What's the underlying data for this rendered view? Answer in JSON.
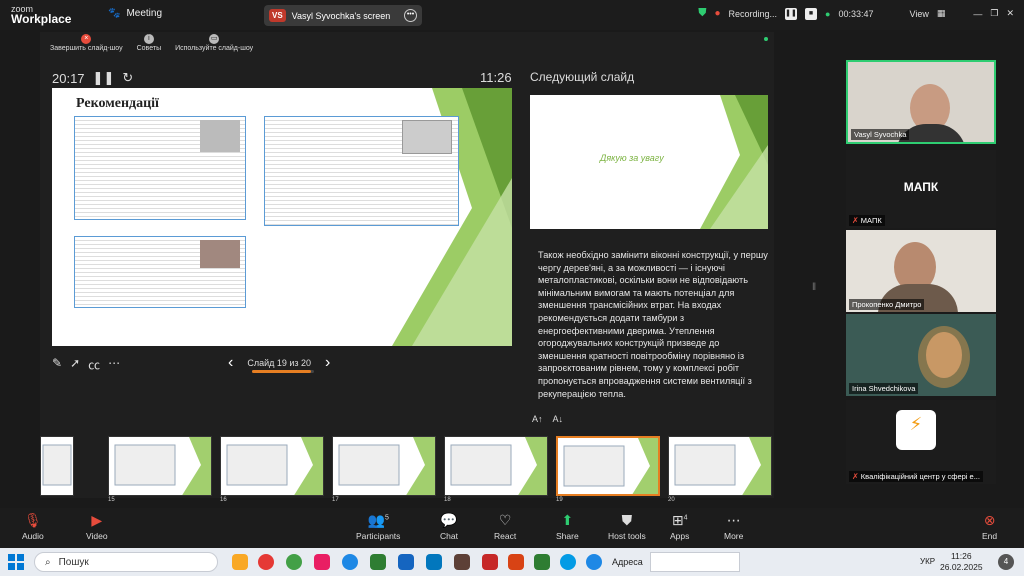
{
  "app": {
    "logo_line1": "zoom",
    "logo_line2": "Workplace",
    "meeting_label": "Meeting"
  },
  "share": {
    "badge": "VS",
    "title": "Vasyl Syvochka's screen"
  },
  "status": {
    "recording": "Recording...",
    "elapsed": "00:33:47",
    "view": "View"
  },
  "presenter": {
    "toolbar": [
      "Завершить слайд-шоу",
      "Советы",
      "Используйте слайд-шоу"
    ],
    "timer": "20:17",
    "clock": "11:26",
    "next_label": "Следующий слайд",
    "slide_nav": "Слайд 19 из 20",
    "progress": 0.95,
    "notes": "Також необхідно замінити віконні конструкції, у першу чергу дерев'яні, а за можливості — і існуючі металопластикові, оскільки вони не відповідають мінімальним вимогам та мають потенціал для зменшення трансмісійних втрат. На входах рекомендується додати тамбури з енергоефективними дверима. Утеплення огороджувальних конструкцій призведе до зменшення кратності повітрообміну порівняно із запроєктованим рівнем, тому у комплексі робіт пропонується впровадження системи вентиляції з рекуперацією тепла."
  },
  "slide": {
    "title": "Рекомендації"
  },
  "next_slide": {
    "text": "Дякую за увагу"
  },
  "thumbnails": [
    "15",
    "16",
    "17",
    "18",
    "19",
    "20"
  ],
  "participants_panel": {
    "tiles": [
      {
        "name": "Vasyl Syvochka"
      },
      {
        "name": "МАПК",
        "label": "МАПК"
      },
      {
        "name": "Прокопенко Дмитро"
      },
      {
        "name": "Irina Shvedchikova"
      },
      {
        "name": "Кваліфікаційний центр у сфері е..."
      }
    ]
  },
  "controls": {
    "audio": "Audio",
    "video": "Video",
    "participants": "Participants",
    "participants_count": "5",
    "chat": "Chat",
    "react": "React",
    "share": "Share",
    "host_tools": "Host tools",
    "apps": "Apps",
    "apps_count": "4",
    "more": "More",
    "end": "End"
  },
  "taskbar": {
    "search": "Пошук",
    "address_label": "Адреса",
    "lang": "УКР",
    "time": "11:26",
    "date": "26.02.2025"
  },
  "colors": {
    "accent_green": "#8bc34a",
    "selected_border": "#e67e22",
    "end_red": "#e74c3c",
    "teal": "#2ecc71"
  }
}
